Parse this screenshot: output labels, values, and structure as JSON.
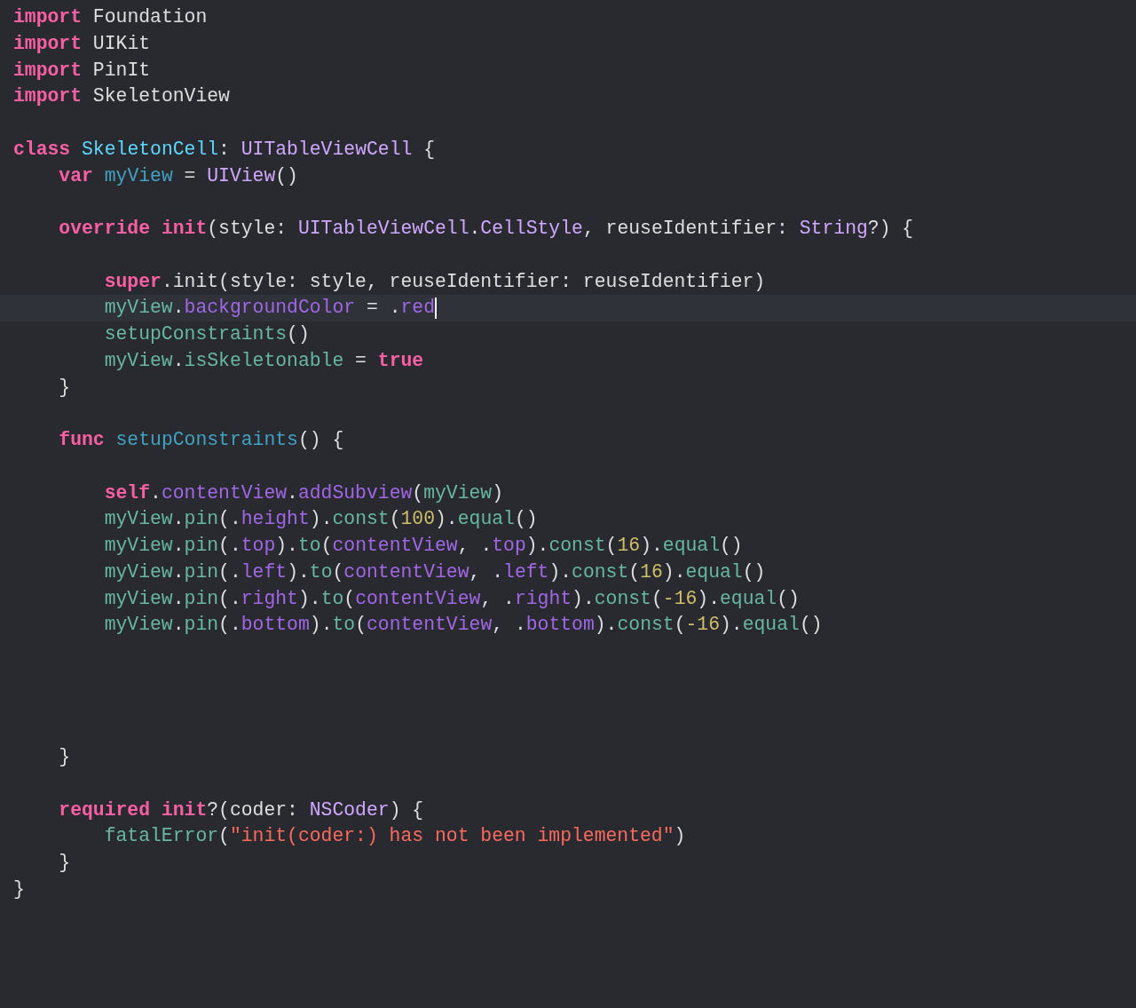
{
  "editor": {
    "lines": [
      {
        "current": false,
        "tokens": [
          {
            "kind": "keyword",
            "text": "import"
          },
          {
            "kind": "plain",
            "text": " Foundation"
          }
        ]
      },
      {
        "current": false,
        "tokens": [
          {
            "kind": "keyword",
            "text": "import"
          },
          {
            "kind": "plain",
            "text": " UIKit"
          }
        ]
      },
      {
        "current": false,
        "tokens": [
          {
            "kind": "keyword",
            "text": "import"
          },
          {
            "kind": "plain",
            "text": " PinIt"
          }
        ]
      },
      {
        "current": false,
        "tokens": [
          {
            "kind": "keyword",
            "text": "import"
          },
          {
            "kind": "plain",
            "text": " SkeletonView"
          }
        ]
      },
      {
        "current": false
      },
      {
        "current": false,
        "tokens": [
          {
            "kind": "keyword",
            "text": "class "
          },
          {
            "kind": "decltype",
            "text": "SkeletonCell"
          },
          {
            "kind": "plain",
            "text": ": "
          },
          {
            "kind": "type",
            "text": "UITableViewCell"
          },
          {
            "kind": "plain",
            "text": " {"
          }
        ]
      },
      {
        "current": false,
        "tokens": [
          {
            "kind": "keyword",
            "text": "    var "
          },
          {
            "kind": "decl",
            "text": "myView"
          },
          {
            "kind": "plain",
            "text": " = "
          },
          {
            "kind": "type",
            "text": "UIView"
          },
          {
            "kind": "plain",
            "text": "()"
          }
        ]
      },
      {
        "current": false
      },
      {
        "current": false,
        "tokens": [
          {
            "kind": "keyword",
            "text": "    override "
          },
          {
            "kind": "keyword",
            "text": "init"
          },
          {
            "kind": "plain",
            "text": "(style: "
          },
          {
            "kind": "type",
            "text": "UITableViewCell"
          },
          {
            "kind": "plain",
            "text": "."
          },
          {
            "kind": "type",
            "text": "CellStyle"
          },
          {
            "kind": "plain",
            "text": ", reuseIdentifier: "
          },
          {
            "kind": "type",
            "text": "String"
          },
          {
            "kind": "plain",
            "text": "?) {"
          }
        ]
      },
      {
        "current": false
      },
      {
        "current": false,
        "tokens": [
          {
            "kind": "keyword",
            "text": "        super"
          },
          {
            "kind": "plain",
            "text": ".init(style: style, reuseIdentifier: reuseIdentifier)"
          }
        ]
      },
      {
        "current": true,
        "tokens": [
          {
            "kind": "project",
            "text": "        myView"
          },
          {
            "kind": "plain",
            "text": "."
          },
          {
            "kind": "member",
            "text": "backgroundColor"
          },
          {
            "kind": "plain",
            "text": " = ."
          },
          {
            "kind": "member",
            "text": "red"
          }
        ]
      },
      {
        "current": false,
        "tokens": [
          {
            "kind": "project",
            "text": "        setupConstraints"
          },
          {
            "kind": "plain",
            "text": "()"
          }
        ]
      },
      {
        "current": false,
        "tokens": [
          {
            "kind": "project",
            "text": "        myView"
          },
          {
            "kind": "plain",
            "text": "."
          },
          {
            "kind": "project",
            "text": "isSkeletonable"
          },
          {
            "kind": "plain",
            "text": " = "
          },
          {
            "kind": "keyword",
            "text": "true"
          }
        ]
      },
      {
        "current": false,
        "tokens": [
          {
            "kind": "plain",
            "text": "    }"
          }
        ]
      },
      {
        "current": false
      },
      {
        "current": false,
        "tokens": [
          {
            "kind": "keyword",
            "text": "    func "
          },
          {
            "kind": "decl",
            "text": "setupConstraints"
          },
          {
            "kind": "plain",
            "text": "() {"
          }
        ]
      },
      {
        "current": false
      },
      {
        "current": false,
        "tokens": [
          {
            "kind": "keyword",
            "text": "        self"
          },
          {
            "kind": "plain",
            "text": "."
          },
          {
            "kind": "member",
            "text": "contentView"
          },
          {
            "kind": "plain",
            "text": "."
          },
          {
            "kind": "member",
            "text": "addSubview"
          },
          {
            "kind": "plain",
            "text": "("
          },
          {
            "kind": "project",
            "text": "myView"
          },
          {
            "kind": "plain",
            "text": ")"
          }
        ]
      },
      {
        "current": false,
        "tokens": [
          {
            "kind": "project",
            "text": "        myView"
          },
          {
            "kind": "plain",
            "text": "."
          },
          {
            "kind": "project",
            "text": "pin"
          },
          {
            "kind": "plain",
            "text": "(."
          },
          {
            "kind": "member",
            "text": "height"
          },
          {
            "kind": "plain",
            "text": ")."
          },
          {
            "kind": "project",
            "text": "const"
          },
          {
            "kind": "plain",
            "text": "("
          },
          {
            "kind": "number",
            "text": "100"
          },
          {
            "kind": "plain",
            "text": ")."
          },
          {
            "kind": "project",
            "text": "equal"
          },
          {
            "kind": "plain",
            "text": "()"
          }
        ]
      },
      {
        "current": false,
        "tokens": [
          {
            "kind": "project",
            "text": "        myView"
          },
          {
            "kind": "plain",
            "text": "."
          },
          {
            "kind": "project",
            "text": "pin"
          },
          {
            "kind": "plain",
            "text": "(."
          },
          {
            "kind": "member",
            "text": "top"
          },
          {
            "kind": "plain",
            "text": ")."
          },
          {
            "kind": "project",
            "text": "to"
          },
          {
            "kind": "plain",
            "text": "("
          },
          {
            "kind": "member",
            "text": "contentView"
          },
          {
            "kind": "plain",
            "text": ", ."
          },
          {
            "kind": "member",
            "text": "top"
          },
          {
            "kind": "plain",
            "text": ")."
          },
          {
            "kind": "project",
            "text": "const"
          },
          {
            "kind": "plain",
            "text": "("
          },
          {
            "kind": "number",
            "text": "16"
          },
          {
            "kind": "plain",
            "text": ")."
          },
          {
            "kind": "project",
            "text": "equal"
          },
          {
            "kind": "plain",
            "text": "()"
          }
        ]
      },
      {
        "current": false,
        "tokens": [
          {
            "kind": "project",
            "text": "        myView"
          },
          {
            "kind": "plain",
            "text": "."
          },
          {
            "kind": "project",
            "text": "pin"
          },
          {
            "kind": "plain",
            "text": "(."
          },
          {
            "kind": "member",
            "text": "left"
          },
          {
            "kind": "plain",
            "text": ")."
          },
          {
            "kind": "project",
            "text": "to"
          },
          {
            "kind": "plain",
            "text": "("
          },
          {
            "kind": "member",
            "text": "contentView"
          },
          {
            "kind": "plain",
            "text": ", ."
          },
          {
            "kind": "member",
            "text": "left"
          },
          {
            "kind": "plain",
            "text": ")."
          },
          {
            "kind": "project",
            "text": "const"
          },
          {
            "kind": "plain",
            "text": "("
          },
          {
            "kind": "number",
            "text": "16"
          },
          {
            "kind": "plain",
            "text": ")."
          },
          {
            "kind": "project",
            "text": "equal"
          },
          {
            "kind": "plain",
            "text": "()"
          }
        ]
      },
      {
        "current": false,
        "tokens": [
          {
            "kind": "project",
            "text": "        myView"
          },
          {
            "kind": "plain",
            "text": "."
          },
          {
            "kind": "project",
            "text": "pin"
          },
          {
            "kind": "plain",
            "text": "(."
          },
          {
            "kind": "member",
            "text": "right"
          },
          {
            "kind": "plain",
            "text": ")."
          },
          {
            "kind": "project",
            "text": "to"
          },
          {
            "kind": "plain",
            "text": "("
          },
          {
            "kind": "member",
            "text": "contentView"
          },
          {
            "kind": "plain",
            "text": ", ."
          },
          {
            "kind": "member",
            "text": "right"
          },
          {
            "kind": "plain",
            "text": ")."
          },
          {
            "kind": "project",
            "text": "const"
          },
          {
            "kind": "plain",
            "text": "("
          },
          {
            "kind": "number",
            "text": "-16"
          },
          {
            "kind": "plain",
            "text": ")."
          },
          {
            "kind": "project",
            "text": "equal"
          },
          {
            "kind": "plain",
            "text": "()"
          }
        ]
      },
      {
        "current": false,
        "tokens": [
          {
            "kind": "project",
            "text": "        myView"
          },
          {
            "kind": "plain",
            "text": "."
          },
          {
            "kind": "project",
            "text": "pin"
          },
          {
            "kind": "plain",
            "text": "(."
          },
          {
            "kind": "member",
            "text": "bottom"
          },
          {
            "kind": "plain",
            "text": ")."
          },
          {
            "kind": "project",
            "text": "to"
          },
          {
            "kind": "plain",
            "text": "("
          },
          {
            "kind": "member",
            "text": "contentView"
          },
          {
            "kind": "plain",
            "text": ", ."
          },
          {
            "kind": "member",
            "text": "bottom"
          },
          {
            "kind": "plain",
            "text": ")."
          },
          {
            "kind": "project",
            "text": "const"
          },
          {
            "kind": "plain",
            "text": "("
          },
          {
            "kind": "number",
            "text": "-16"
          },
          {
            "kind": "plain",
            "text": ")."
          },
          {
            "kind": "project",
            "text": "equal"
          },
          {
            "kind": "plain",
            "text": "()"
          }
        ]
      },
      {
        "current": false
      },
      {
        "current": false
      },
      {
        "current": false
      },
      {
        "current": false
      },
      {
        "current": false,
        "tokens": [
          {
            "kind": "plain",
            "text": "    }"
          }
        ]
      },
      {
        "current": false
      },
      {
        "current": false,
        "tokens": [
          {
            "kind": "keyword",
            "text": "    required "
          },
          {
            "kind": "keyword",
            "text": "init"
          },
          {
            "kind": "plain",
            "text": "?(coder: "
          },
          {
            "kind": "type",
            "text": "NSCoder"
          },
          {
            "kind": "plain",
            "text": ") {"
          }
        ]
      },
      {
        "current": false,
        "tokens": [
          {
            "kind": "project",
            "text": "        fatalError"
          },
          {
            "kind": "plain",
            "text": "("
          },
          {
            "kind": "string",
            "text": "\"init(coder:) has not been implemented\""
          },
          {
            "kind": "plain",
            "text": ")"
          }
        ]
      },
      {
        "current": false,
        "tokens": [
          {
            "kind": "plain",
            "text": "    }"
          }
        ]
      },
      {
        "current": false,
        "tokens": [
          {
            "kind": "plain",
            "text": "}"
          }
        ]
      }
    ]
  }
}
